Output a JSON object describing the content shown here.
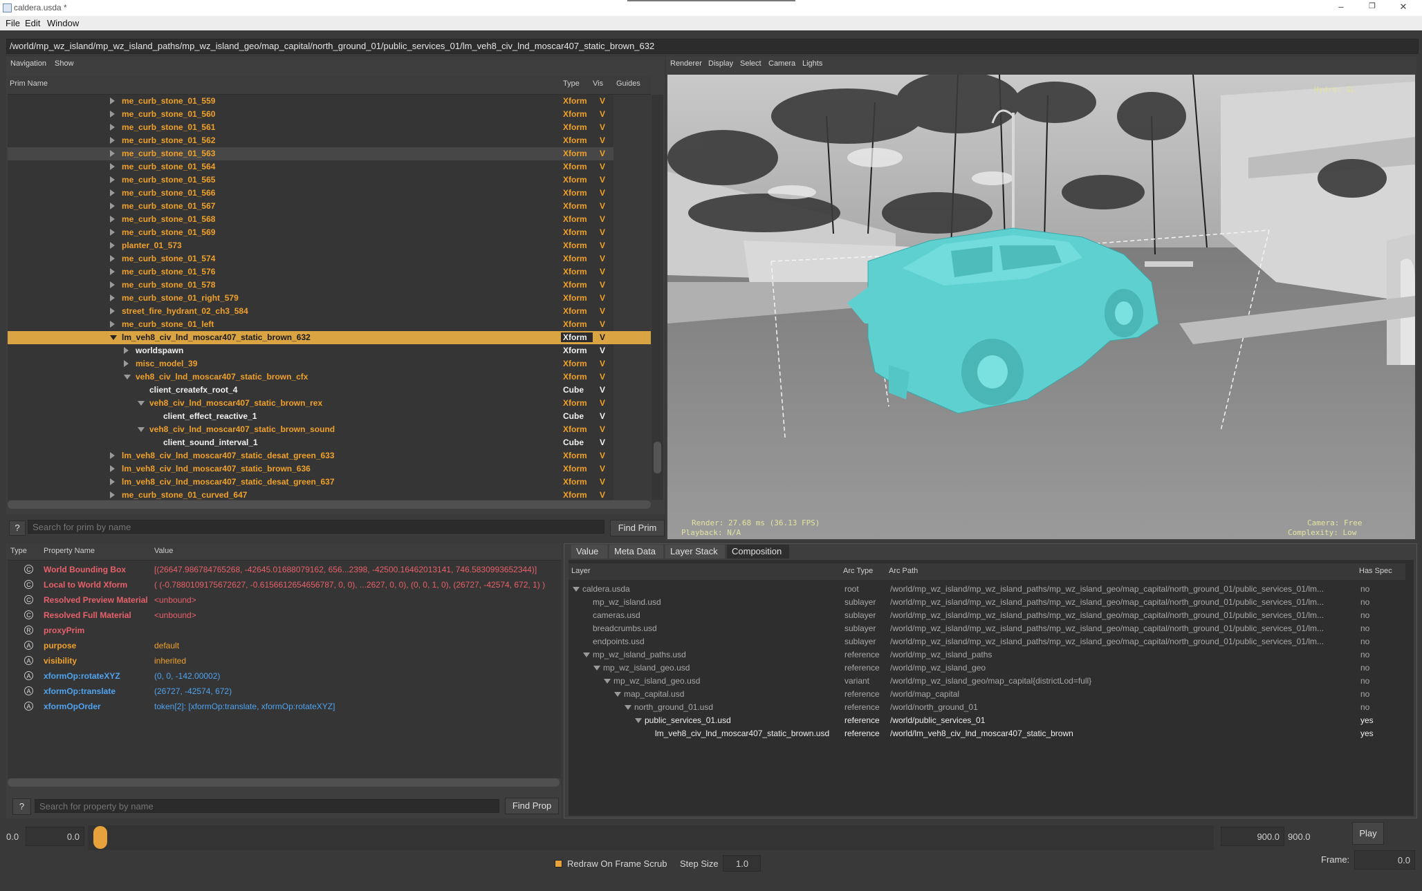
{
  "window": {
    "title": "caldera.usda *"
  },
  "menu": [
    "File",
    "Edit",
    "Window"
  ],
  "path": "/world/mp_wz_island/mp_wz_island_paths/mp_wz_island_geo/map_capital/north_ground_01/public_services_01/lm_veh8_civ_lnd_moscar407_static_brown_632",
  "navigation": {
    "tabs": [
      "Navigation",
      "Show"
    ],
    "columns": {
      "name": "Prim Name",
      "type": "Type",
      "vis": "Vis",
      "guides": "Guides"
    },
    "rows": [
      {
        "name": "me_curb_stone_01_559",
        "type": "Xform",
        "vis": "V",
        "indent": 0,
        "arrow": "right",
        "color": "orange"
      },
      {
        "name": "me_curb_stone_01_560",
        "type": "Xform",
        "vis": "V",
        "indent": 0,
        "arrow": "right",
        "color": "orange"
      },
      {
        "name": "me_curb_stone_01_561",
        "type": "Xform",
        "vis": "V",
        "indent": 0,
        "arrow": "right",
        "color": "orange"
      },
      {
        "name": "me_curb_stone_01_562",
        "type": "Xform",
        "vis": "V",
        "indent": 0,
        "arrow": "right",
        "color": "orange"
      },
      {
        "name": "me_curb_stone_01_563",
        "type": "Xform",
        "vis": "V",
        "indent": 0,
        "arrow": "right",
        "color": "orange",
        "hover": true
      },
      {
        "name": "me_curb_stone_01_564",
        "type": "Xform",
        "vis": "V",
        "indent": 0,
        "arrow": "right",
        "color": "orange"
      },
      {
        "name": "me_curb_stone_01_565",
        "type": "Xform",
        "vis": "V",
        "indent": 0,
        "arrow": "right",
        "color": "orange"
      },
      {
        "name": "me_curb_stone_01_566",
        "type": "Xform",
        "vis": "V",
        "indent": 0,
        "arrow": "right",
        "color": "orange"
      },
      {
        "name": "me_curb_stone_01_567",
        "type": "Xform",
        "vis": "V",
        "indent": 0,
        "arrow": "right",
        "color": "orange"
      },
      {
        "name": "me_curb_stone_01_568",
        "type": "Xform",
        "vis": "V",
        "indent": 0,
        "arrow": "right",
        "color": "orange"
      },
      {
        "name": "me_curb_stone_01_569",
        "type": "Xform",
        "vis": "V",
        "indent": 0,
        "arrow": "right",
        "color": "orange"
      },
      {
        "name": "planter_01_573",
        "type": "Xform",
        "vis": "V",
        "indent": 0,
        "arrow": "right",
        "color": "orange"
      },
      {
        "name": "me_curb_stone_01_574",
        "type": "Xform",
        "vis": "V",
        "indent": 0,
        "arrow": "right",
        "color": "orange"
      },
      {
        "name": "me_curb_stone_01_576",
        "type": "Xform",
        "vis": "V",
        "indent": 0,
        "arrow": "right",
        "color": "orange"
      },
      {
        "name": "me_curb_stone_01_578",
        "type": "Xform",
        "vis": "V",
        "indent": 0,
        "arrow": "right",
        "color": "orange"
      },
      {
        "name": "me_curb_stone_01_right_579",
        "type": "Xform",
        "vis": "V",
        "indent": 0,
        "arrow": "right",
        "color": "orange"
      },
      {
        "name": "street_fire_hydrant_02_ch3_584",
        "type": "Xform",
        "vis": "V",
        "indent": 0,
        "arrow": "right",
        "color": "orange"
      },
      {
        "name": "me_curb_stone_01_left",
        "type": "Xform",
        "vis": "V",
        "indent": 0,
        "arrow": "right",
        "color": "orange"
      },
      {
        "name": "lm_veh8_civ_lnd_moscar407_static_brown_632",
        "type": "Xform",
        "vis": "V",
        "indent": 0,
        "arrow": "down",
        "color": "selected",
        "selected": true
      },
      {
        "name": "worldspawn",
        "type": "Xform",
        "vis": "V",
        "indent": 1,
        "arrow": "right",
        "color": "white"
      },
      {
        "name": "misc_model_39",
        "type": "Xform",
        "vis": "V",
        "indent": 1,
        "arrow": "right",
        "color": "orange"
      },
      {
        "name": "veh8_civ_lnd_moscar407_static_brown_cfx",
        "type": "Xform",
        "vis": "V",
        "indent": 1,
        "arrow": "down",
        "color": "orange"
      },
      {
        "name": "client_createfx_root_4",
        "type": "Cube",
        "vis": "V",
        "indent": 2,
        "arrow": "none",
        "color": "white"
      },
      {
        "name": "veh8_civ_lnd_moscar407_static_brown_rex",
        "type": "Xform",
        "vis": "V",
        "indent": 2,
        "arrow": "down",
        "color": "orange"
      },
      {
        "name": "client_effect_reactive_1",
        "type": "Cube",
        "vis": "V",
        "indent": 3,
        "arrow": "none",
        "color": "white"
      },
      {
        "name": "veh8_civ_lnd_moscar407_static_brown_sound",
        "type": "Xform",
        "vis": "V",
        "indent": 2,
        "arrow": "down",
        "color": "orange"
      },
      {
        "name": "client_sound_interval_1",
        "type": "Cube",
        "vis": "V",
        "indent": 3,
        "arrow": "none",
        "color": "white"
      },
      {
        "name": "lm_veh8_civ_lnd_moscar407_static_desat_green_633",
        "type": "Xform",
        "vis": "V",
        "indent": 0,
        "arrow": "right",
        "color": "orange"
      },
      {
        "name": "lm_veh8_civ_lnd_moscar407_static_brown_636",
        "type": "Xform",
        "vis": "V",
        "indent": 0,
        "arrow": "right",
        "color": "orange"
      },
      {
        "name": "lm_veh8_civ_lnd_moscar407_static_desat_green_637",
        "type": "Xform",
        "vis": "V",
        "indent": 0,
        "arrow": "right",
        "color": "orange"
      },
      {
        "name": "me_curb_stone_01_curved_647",
        "type": "Xform",
        "vis": "V",
        "indent": 0,
        "arrow": "right",
        "color": "orange"
      }
    ],
    "help_label": "?",
    "search_placeholder": "Search for prim by name",
    "find_label": "Find Prim"
  },
  "properties": {
    "columns": {
      "type": "Type",
      "name": "Property Name",
      "value": "Value"
    },
    "rows": [
      {
        "icon": "C",
        "name": "World Bounding Box",
        "value": "[(26647.986784765268, -42645.01688079162, 656...2398, -42500.16462013141, 746.5830993652344)]",
        "color": "red"
      },
      {
        "icon": "C",
        "name": "Local to World Xform",
        "value": "( (-0.7880109175672627, -0.6156612654656787, 0, 0), ...2627, 0, 0), (0, 0, 1, 0), (26727, -42574, 672, 1) )",
        "color": "red"
      },
      {
        "icon": "C",
        "name": "Resolved Preview Material",
        "value": "<unbound>",
        "color": "red"
      },
      {
        "icon": "C",
        "name": "Resolved Full Material",
        "value": "<unbound>",
        "color": "red"
      },
      {
        "icon": "R",
        "name": "proxyPrim",
        "value": "",
        "color": "red"
      },
      {
        "icon": "A",
        "name": "purpose",
        "value": "default",
        "color": "orange"
      },
      {
        "icon": "A",
        "name": "visibility",
        "value": "inherited",
        "color": "orange"
      },
      {
        "icon": "A",
        "name": "xformOp:rotateXYZ",
        "value": "(0, 0, -142.00002)",
        "color": "blue"
      },
      {
        "icon": "A",
        "name": "xformOp:translate",
        "value": "(26727, -42574, 672)",
        "color": "blue"
      },
      {
        "icon": "A",
        "name": "xformOpOrder",
        "value": "token[2]: [xformOp:translate, xformOp:rotateXYZ]",
        "color": "blue"
      }
    ],
    "help_label": "?",
    "search_placeholder": "Search for property by name",
    "find_label": "Find Prop"
  },
  "viewport": {
    "menu": [
      "Renderer",
      "Display",
      "Select",
      "Camera",
      "Lights"
    ],
    "hud_top_right": "Hydra: GL",
    "hud_render": "Render: 27.68 ms (36.13 FPS)",
    "hud_playback": "Playback: N/A",
    "hud_camera": "Camera: Free",
    "hud_complexity": "Complexity: Low"
  },
  "composition": {
    "tabs": [
      "Value",
      "Meta Data",
      "Layer Stack",
      "Composition"
    ],
    "active_tab": "Composition",
    "columns": {
      "layer": "Layer",
      "arc_type": "Arc Type",
      "arc_path": "Arc Path",
      "has_spec": "Has Spec"
    },
    "rows": [
      {
        "layer": "caldera.usda",
        "arc": "root",
        "path": "/world/mp_wz_island/mp_wz_island_paths/mp_wz_island_geo/map_capital/north_ground_01/public_services_01/lm...",
        "spec": "no",
        "indent": 0,
        "arrow": "down"
      },
      {
        "layer": "mp_wz_island.usd",
        "arc": "sublayer",
        "path": "/world/mp_wz_island/mp_wz_island_paths/mp_wz_island_geo/map_capital/north_ground_01/public_services_01/lm...",
        "spec": "no",
        "indent": 1,
        "arrow": "none"
      },
      {
        "layer": "cameras.usd",
        "arc": "sublayer",
        "path": "/world/mp_wz_island/mp_wz_island_paths/mp_wz_island_geo/map_capital/north_ground_01/public_services_01/lm...",
        "spec": "no",
        "indent": 1,
        "arrow": "none"
      },
      {
        "layer": "breadcrumbs.usd",
        "arc": "sublayer",
        "path": "/world/mp_wz_island/mp_wz_island_paths/mp_wz_island_geo/map_capital/north_ground_01/public_services_01/lm...",
        "spec": "no",
        "indent": 1,
        "arrow": "none"
      },
      {
        "layer": "endpoints.usd",
        "arc": "sublayer",
        "path": "/world/mp_wz_island/mp_wz_island_paths/mp_wz_island_geo/map_capital/north_ground_01/public_services_01/lm...",
        "spec": "no",
        "indent": 1,
        "arrow": "none"
      },
      {
        "layer": "mp_wz_island_paths.usd",
        "arc": "reference",
        "path": "/world/mp_wz_island_paths",
        "spec": "no",
        "indent": 1,
        "arrow": "down"
      },
      {
        "layer": "mp_wz_island_geo.usd",
        "arc": "reference",
        "path": "/world/mp_wz_island_geo",
        "spec": "no",
        "indent": 2,
        "arrow": "down"
      },
      {
        "layer": "mp_wz_island_geo.usd",
        "arc": "variant",
        "path": "/world/mp_wz_island_geo/map_capital{districtLod=full}",
        "spec": "no",
        "indent": 3,
        "arrow": "down"
      },
      {
        "layer": "map_capital.usd",
        "arc": "reference",
        "path": "/world/map_capital",
        "spec": "no",
        "indent": 4,
        "arrow": "down"
      },
      {
        "layer": "north_ground_01.usd",
        "arc": "reference",
        "path": "/world/north_ground_01",
        "spec": "no",
        "indent": 5,
        "arrow": "down"
      },
      {
        "layer": "public_services_01.usd",
        "arc": "reference",
        "path": "/world/public_services_01",
        "spec": "yes",
        "indent": 6,
        "arrow": "down",
        "highlight": true
      },
      {
        "layer": "lm_veh8_civ_lnd_moscar407_static_brown.usd",
        "arc": "reference",
        "path": "/world/lm_veh8_civ_lnd_moscar407_static_brown",
        "spec": "yes",
        "indent": 7,
        "arrow": "none",
        "highlight": true
      }
    ]
  },
  "timeline": {
    "start_left": "0.0",
    "start_field": "0.0",
    "end_field": "900.0",
    "end_right": "900.0",
    "play_label": "Play",
    "redraw_label": "Redraw On Frame Scrub",
    "redraw_checked": true,
    "step_label": "Step Size",
    "step_value": "1.0",
    "frame_label": "Frame:",
    "frame_value": "0.0",
    "scrub_position": 0.0
  },
  "colors": {
    "accent": "#e8a23b",
    "selected_row": "#d9a441",
    "orange_text": "#f0a12a",
    "red_text": "#e8606a",
    "blue_text": "#4fa3ef",
    "car": "#5fd0d0"
  }
}
